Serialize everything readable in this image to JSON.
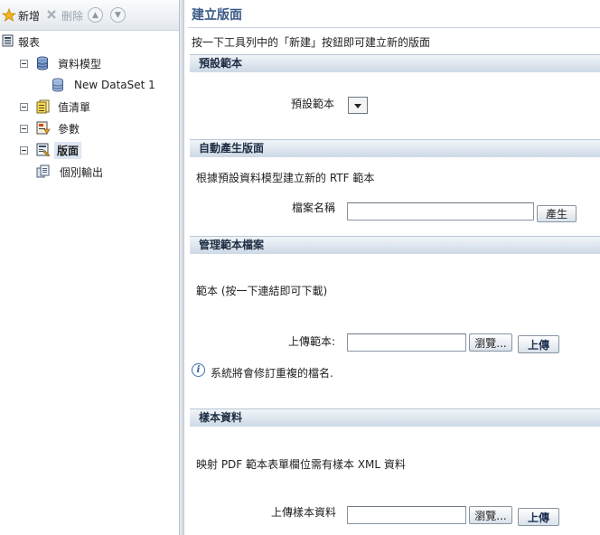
{
  "toolbar": {
    "new_label": "新增",
    "delete_label": "刪除",
    "move_up_icon": "up-circle-icon",
    "move_down_icon": "down-circle-icon"
  },
  "tree": {
    "root": "報表",
    "items": [
      {
        "label": "資料模型",
        "icon": "database-icon"
      },
      {
        "label": "New DataSet 1",
        "icon": "dataset-icon"
      },
      {
        "label": "值清單",
        "icon": "list-of-values-icon"
      },
      {
        "label": "參數",
        "icon": "parameters-icon"
      },
      {
        "label": "版面",
        "icon": "layout-icon"
      },
      {
        "label": "個別輸出",
        "icon": "bursting-icon"
      }
    ]
  },
  "main": {
    "title": "建立版面",
    "intro": "按一下工具列中的「新建」按鈕即可建立新的版面",
    "sections": {
      "default_template": {
        "heading": "預設範本",
        "label": "預設範本"
      },
      "auto_generate": {
        "heading": "自動產生版面",
        "description": "根據預設資料模型建立新的 RTF 範本",
        "file_label": "檔案名稱",
        "file_value": "",
        "generate_button": "產生"
      },
      "manage_templates": {
        "heading": "管理範本檔案",
        "description": "範本 (按一下連結即可下載)",
        "upload_label": "上傳範本:",
        "upload_value": "",
        "browse_button": "瀏覽...",
        "upload_button": "上傳",
        "info_text": "系統將會修訂重複的檔名."
      },
      "sample_data": {
        "heading": "樣本資料",
        "description": "映射 PDF 範本表單欄位需有樣本 XML 資料",
        "upload_label": "上傳樣本資料",
        "upload_value": "",
        "browse_button": "瀏覽...",
        "upload_button": "上傳"
      }
    }
  },
  "colors": {
    "title": "#3b5a87",
    "section_header": "#cdd9e6",
    "tree_selected": "#dde6f3"
  }
}
